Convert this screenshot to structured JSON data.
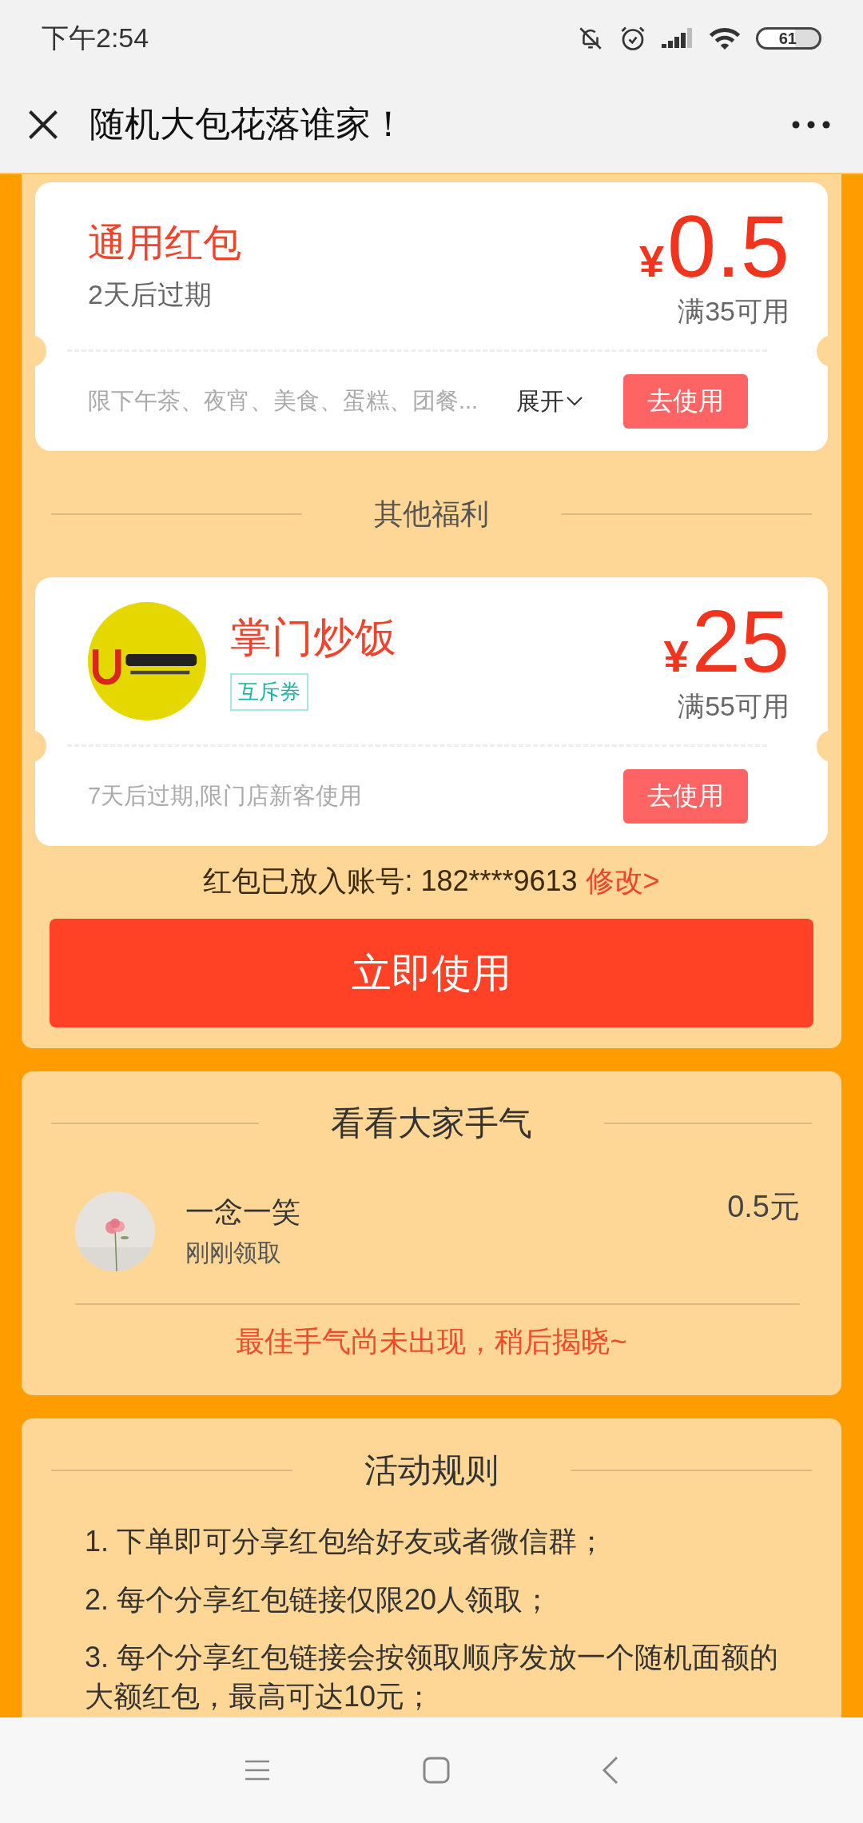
{
  "status_bar": {
    "time": "下午2:54",
    "battery": "61"
  },
  "header": {
    "title": "随机大包花落谁家！"
  },
  "coupons": [
    {
      "kind": "general",
      "title": "通用红包",
      "expiry": "2天后过期",
      "currency": "¥",
      "amount": "0.5",
      "condition": "满35可用",
      "note": "限下午茶、夜宵、美食、蛋糕、团餐...",
      "expand": "展开",
      "action": "去使用"
    }
  ],
  "other_benefits": {
    "heading": "其他福利",
    "coupons": [
      {
        "kind": "shop",
        "title": "掌门炒饭",
        "tag": "互斥券",
        "currency": "¥",
        "amount": "25",
        "condition": "满55可用",
        "note": "7天后过期,限门店新客使用",
        "action": "去使用"
      }
    ]
  },
  "account": {
    "label": "红包已放入账号: 182****9613",
    "link": "修改>"
  },
  "use_button": "立即使用",
  "luck": {
    "heading": "看看大家手气",
    "records": [
      {
        "name": "一念一笑",
        "time": "刚刚领取",
        "amount": "0.5元"
      }
    ],
    "notice": "最佳手气尚未出现，稍后揭晓~"
  },
  "rules": {
    "heading": "活动规则",
    "items": [
      "1. 下单即可分享红包给好友或者微信群；",
      "2. 每个分享红包链接仅限20人领取；",
      "3. 每个分享红包链接会按领取顺序发放一个随机面额的大额红包，最高可达10元；"
    ]
  }
}
